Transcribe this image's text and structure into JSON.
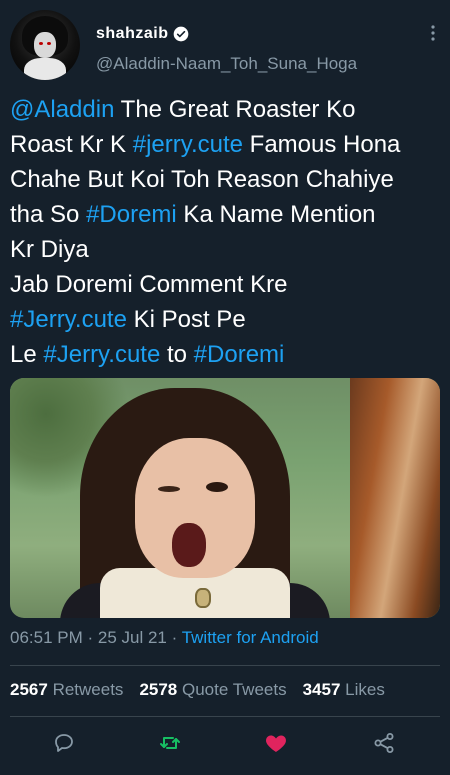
{
  "tweet": {
    "display_name": "shahzaib",
    "handle": "@Aladdin-Naam_Toh_Suna_Hoga",
    "lines": [
      [
        {
          "t": "@Aladdin",
          "link": true
        },
        {
          "t": " The Great Roaster Ko",
          "link": false
        }
      ],
      [
        {
          "t": "Roast Kr K ",
          "link": false
        },
        {
          "t": "#jerry.cute",
          "link": true
        },
        {
          "t": " Famous Hona",
          "link": false
        }
      ],
      [
        {
          "t": "Chahe But Koi Toh Reason Chahiye",
          "link": false
        }
      ],
      [
        {
          "t": "tha So ",
          "link": false
        },
        {
          "t": "#Doremi",
          "link": true
        },
        {
          "t": " Ka Name Mention",
          "link": false
        }
      ],
      [
        {
          "t": "Kr Diya",
          "link": false
        }
      ],
      [
        {
          "t": "Jab Doremi Comment Kre",
          "link": false
        }
      ],
      [
        {
          "t": "#Jerry.cute",
          "link": true
        },
        {
          "t": " Ki Post Pe",
          "link": false
        }
      ],
      [
        {
          "t": "Le ",
          "link": false
        },
        {
          "t": "#Jerry.cute",
          "link": true
        },
        {
          "t": " to ",
          "link": false
        },
        {
          "t": "#Doremi",
          "link": true
        }
      ]
    ],
    "time": "06:51 PM",
    "separator": " · ",
    "date": "25 Jul 21",
    "source": "Twitter for Android"
  },
  "stats": {
    "retweets_count": "2567",
    "retweets_label": "Retweets",
    "quotes_count": "2578",
    "quotes_label": "Quote Tweets",
    "likes_count": "3457",
    "likes_label": "Likes"
  },
  "icons": {
    "reply": "reply-icon",
    "retweet": "retweet-icon",
    "like": "heart-icon",
    "share": "share-icon",
    "verified": "verified-badge-icon",
    "menu": "more-vertical-icon"
  },
  "colors": {
    "background": "#15202b",
    "accent": "#1da1f2",
    "muted": "#8899a6",
    "retweet_active": "#17bf63",
    "like_active": "#e0245e"
  }
}
